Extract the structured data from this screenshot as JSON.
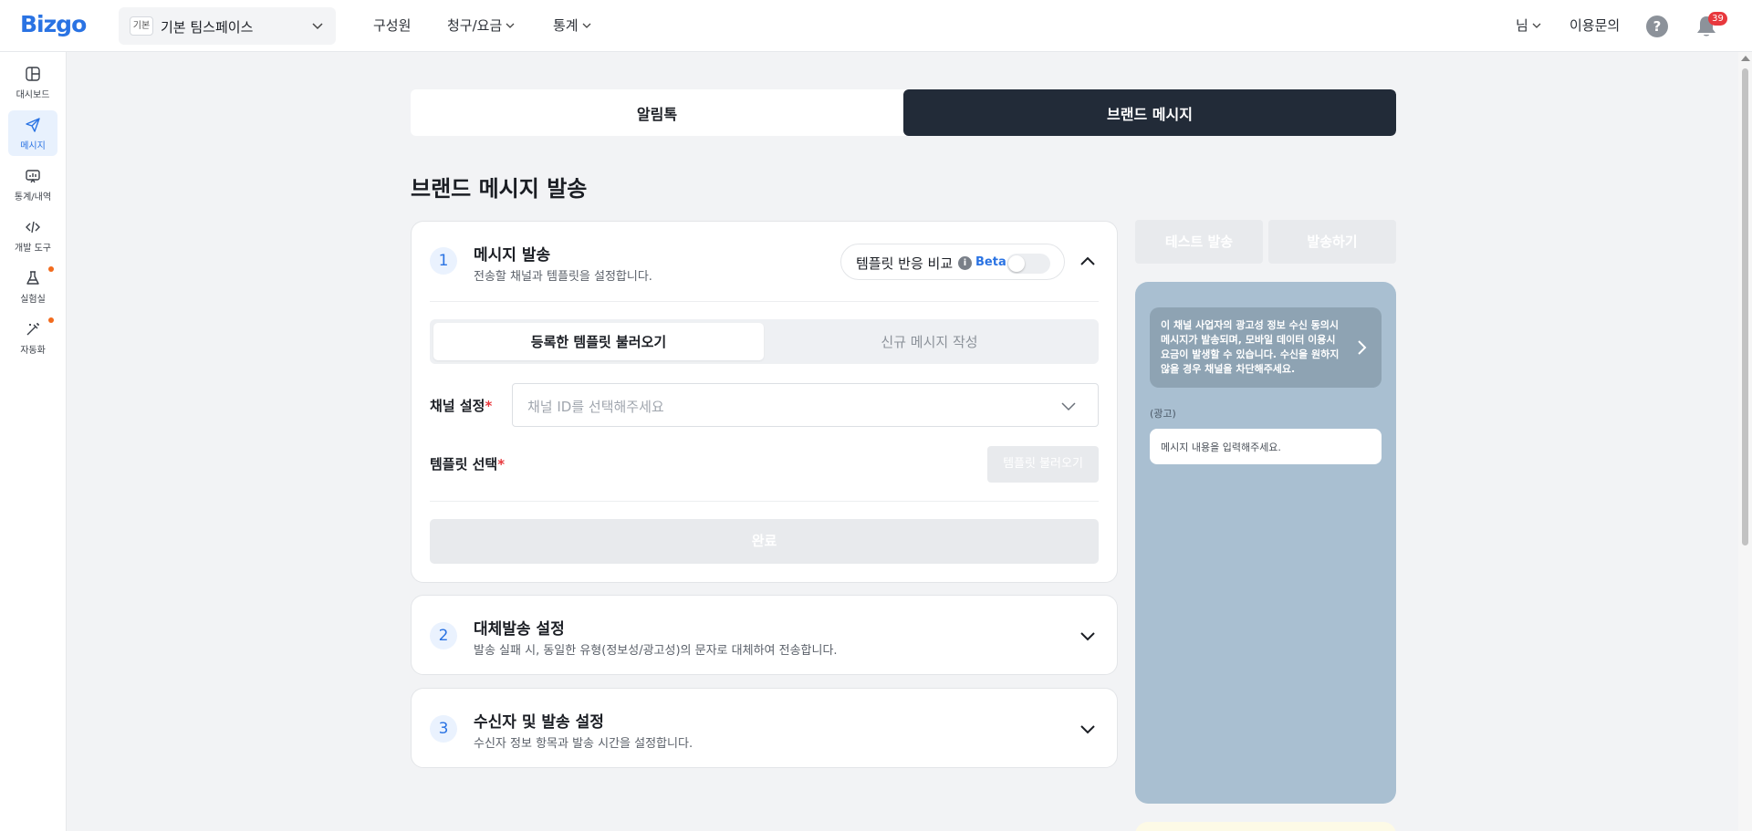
{
  "app": {
    "logo": "Bizgo"
  },
  "workspace": {
    "badge": "기본",
    "name": "기본 팀스페이스"
  },
  "topnav": {
    "items": [
      {
        "label": "구성원"
      },
      {
        "label": "청구/요금"
      },
      {
        "label": "통계"
      }
    ]
  },
  "topright": {
    "user": "님",
    "support": "이용문의",
    "help": "?",
    "notifications": "39"
  },
  "sidebar": {
    "items": [
      {
        "label": "대시보드"
      },
      {
        "label": "메시지"
      },
      {
        "label": "통계/내역"
      },
      {
        "label": "개발 도구"
      },
      {
        "label": "실험실"
      },
      {
        "label": "자동화"
      }
    ]
  },
  "tabs": [
    {
      "label": "알림톡"
    },
    {
      "label": "브랜드 메시지"
    }
  ],
  "page": {
    "title": "브랜드 메시지 발송"
  },
  "step1": {
    "num": "1",
    "title": "메시지 발송",
    "desc": "전송할 채널과 템플릿을 설정합니다.",
    "compare_label": "템플릿 반응 비교",
    "info": "i",
    "beta": "Beta",
    "segments": [
      "등록한 템플릿 불러오기",
      "신규 메시지 작성"
    ],
    "channel_label": "채널 설정",
    "channel_placeholder": "채널 ID를 선택해주세요",
    "template_label": "템플릿 선택",
    "required": "*",
    "load_button": "템플릿 불러오기",
    "done_button": "완료"
  },
  "step2": {
    "num": "2",
    "title": "대체발송 설정",
    "desc": "발송 실패 시, 동일한 유형(정보성/광고성)의 문자로 대체하여 전송합니다."
  },
  "step3": {
    "num": "3",
    "title": "수신자 및 발송 설정",
    "desc": "수신자 정보 항목과 발송 시간을 설정합니다."
  },
  "actions": {
    "test_send": "테스트 발송",
    "send": "발송하기"
  },
  "preview": {
    "notice": "이 채널 사업자의 광고성 정보 수신 동의시 메시지가 발송되며, 모바일 데이터 이용시 요금이 발생할 수 있습니다. 수신을 원하지 않을 경우 채널을 차단해주세요.",
    "ad_label": "(광고)",
    "bubble": "메시지 내용을 입력해주세요."
  },
  "colors": {
    "brand": "#2a73e3",
    "dark_tab": "#222b38",
    "preview_bg": "#a9bfd1",
    "badge_red": "#e8383d",
    "dot_orange": "#f26b1d"
  }
}
